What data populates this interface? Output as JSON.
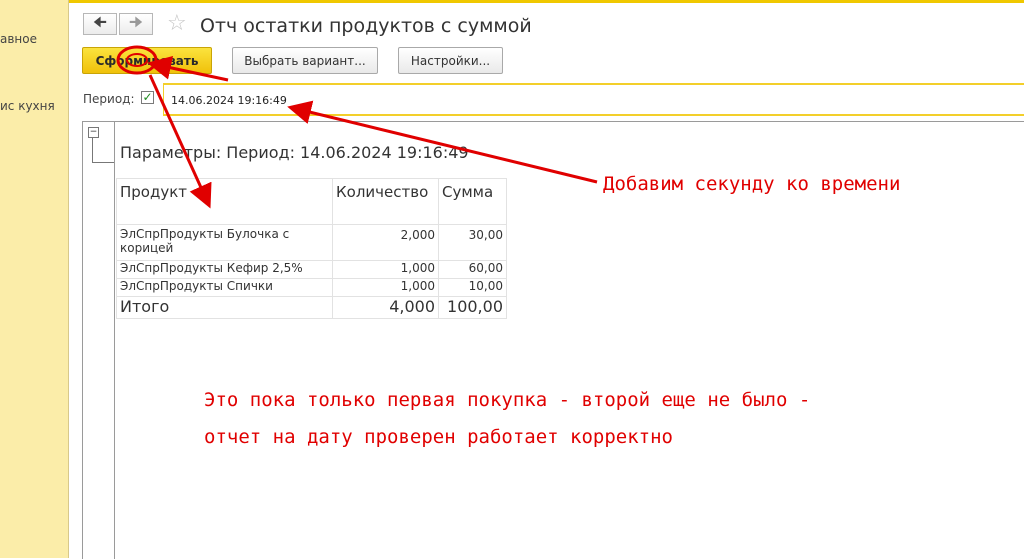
{
  "sidebar": {
    "items": [
      {
        "label": "авное"
      },
      {
        "label": "ис кухня"
      }
    ]
  },
  "header": {
    "back_icon": "arrow-left-icon",
    "forward_icon": "arrow-right-icon",
    "favorite_icon": "star-icon",
    "title": "Отч остатки продуктов с суммой"
  },
  "toolbar": {
    "generate_label": "Сформировать",
    "variant_label": "Выбрать вариант...",
    "settings_label": "Настройки..."
  },
  "period": {
    "label": "Период:",
    "checked": true,
    "value": "14.06.2024 19:16:49"
  },
  "report": {
    "params_text": "Параметры:  Период: 14.06.2024 19:16:49",
    "columns": [
      "Продукт",
      "Количество",
      "Сумма"
    ],
    "rows": [
      {
        "product": "ЭлСпрПродукты Булочка с корицей",
        "qty": "2,000",
        "sum": "30,00"
      },
      {
        "product": "ЭлСпрПродукты Кефир 2,5%",
        "qty": "1,000",
        "sum": "60,00"
      },
      {
        "product": "ЭлСпрПродукты Спички",
        "qty": "1,000",
        "sum": "10,00"
      }
    ],
    "total": {
      "label": "Итого",
      "qty": "4,000",
      "sum": "100,00"
    }
  },
  "annotations": {
    "note_time": "Добавим секунду ко времени",
    "note_line1": "Это пока только первая покупка - второй еще не было -",
    "note_line2": "отчет на дату проверен работает корректно",
    "color": "#e00000"
  },
  "colors": {
    "accent_yellow": "#f0c10a",
    "sidebar_bg": "#fbeda9"
  }
}
